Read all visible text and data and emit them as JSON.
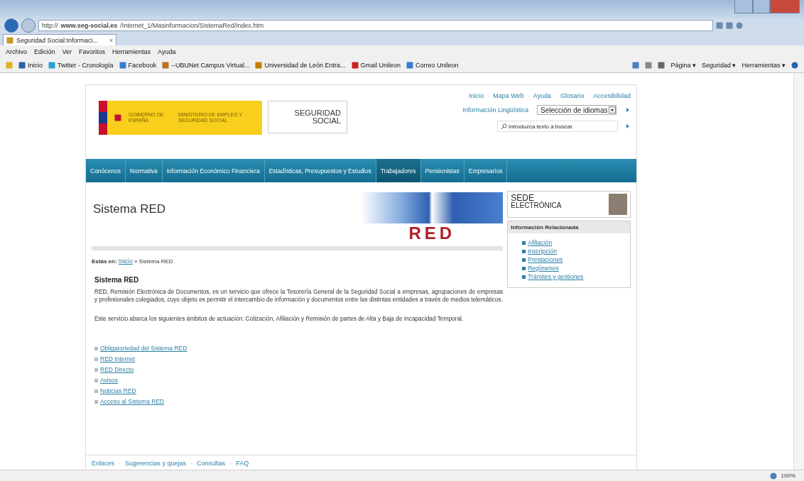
{
  "browser": {
    "address_prefix": "http://",
    "address_domain": "www.seg-social.es",
    "address_path": "/Internet_1/Masinformacion/SistemaRed/index.htm",
    "tab": "Seguridad Social:Informaci...",
    "tab_close": "×",
    "menu": [
      "Archivo",
      "Edición",
      "Ver",
      "Favoritos",
      "Herramientas",
      "Ayuda"
    ],
    "favorites": [
      "Inicio",
      "Twitter - Cronología",
      "Facebook",
      "--UBUNet Campus Virtual...",
      "Universidad de León Entra...",
      "Gmail Unileon",
      "Correo Unileon"
    ],
    "commands": [
      "Página ▾",
      "Seguridad ▾",
      "Herramientas ▾"
    ],
    "zoom": "100%"
  },
  "header": {
    "logo_gov": "GOBIERNO DE ESPAÑA",
    "logo_ministry": "MINISTERIO DE EMPLEO Y SEGURIDAD SOCIAL",
    "logo_ss": "SEGURIDAD SOCIAL",
    "top_links": [
      "Inicio",
      "Mapa Web",
      "Ayuda",
      "Glosario",
      "Accesibilidad"
    ],
    "top_links_separator": "·",
    "language_label": "Información Lingüística",
    "language_select": "Selección de idiomas",
    "search": {
      "placeholder": "Introduzca texto a buscar"
    }
  },
  "nav": [
    {
      "label": "Conócenos",
      "selected": false
    },
    {
      "label": "Normativa",
      "selected": false
    },
    {
      "label": "Información Económico Financiera",
      "selected": false
    },
    {
      "label": "Estadísticas, Presupuestos y Estudios",
      "selected": false
    },
    {
      "label": "Trabajadores",
      "selected": true
    },
    {
      "label": "Pensionistas",
      "selected": false
    },
    {
      "label": "Empresarios",
      "selected": false
    }
  ],
  "page": {
    "title": "Sistema RED",
    "banner_text": "RED",
    "breadcrumb_label": "Estás en:",
    "breadcrumb": [
      "Inicio",
      "Sistema RED"
    ],
    "breadcrumb_separator": "»",
    "section_title": "Sistema RED",
    "paragraphs": [
      "RED, Remisión Electrónica de Documentos, es un servicio que ofrece la Tesorería General de la Seguridad Social a empresas, agrupaciones de empresas y profesionales colegiados, cuyo objeto es permitir el intercambio de información y documentos entre las distintas entidades a través de medios telemáticos.",
      "Este servicio abarca los siguientes ámbitos de actuación: Cotización, Afiliación y Remisión de partes de Alta y Baja de Incapacidad Temporal."
    ],
    "links": [
      "Obligatoriedad del Sistema RED",
      "RED Internet",
      "RED Directo",
      "Avisos",
      "Noticias RED",
      "Acceso al Sistema RED"
    ]
  },
  "sidebar": {
    "sede_line1": "SEDE",
    "sede_line2": "ELECTRÓNICA",
    "related_title": "Información Relacionada",
    "related": [
      "Afiliación",
      "Inscripción",
      "Prestaciones",
      "Regímenes",
      "Trámites y gestiones"
    ]
  },
  "footer": [
    "Enlaces",
    "Sugerencias y quejas",
    "Consultas",
    "FAQ"
  ],
  "footer_separator": "·"
}
